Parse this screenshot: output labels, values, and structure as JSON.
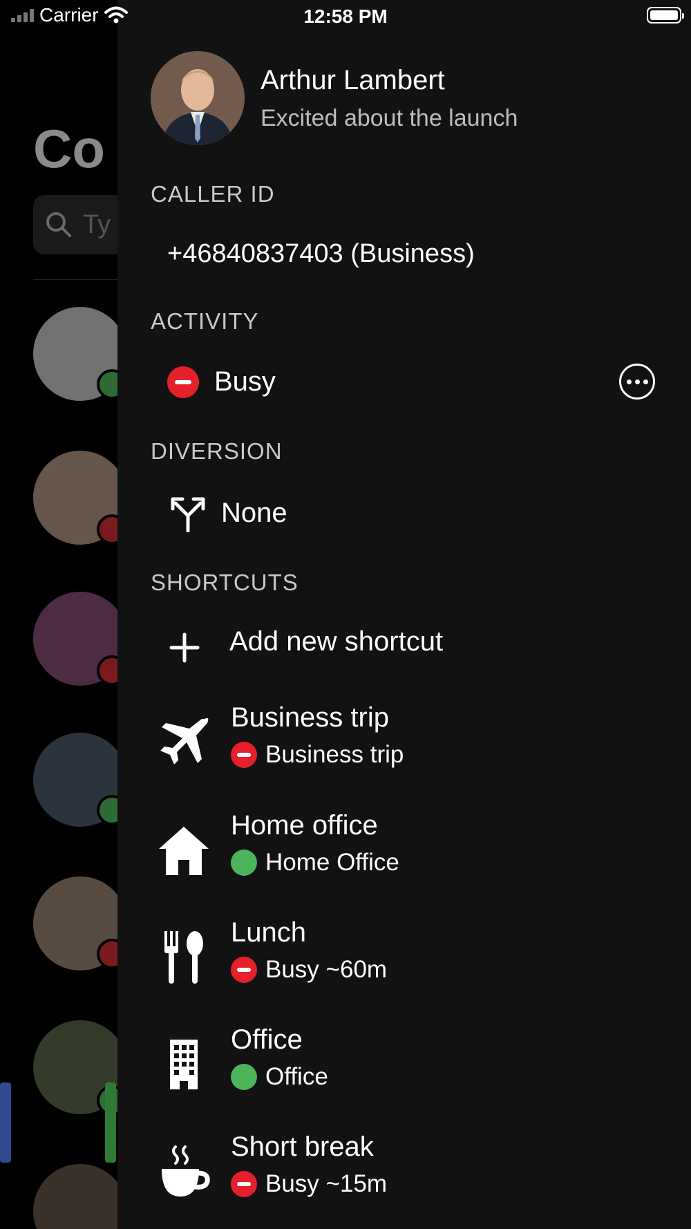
{
  "status_bar": {
    "carrier": "Carrier",
    "time": "12:58 PM"
  },
  "background": {
    "title_partial": "Co",
    "search_placeholder_partial": "Ty"
  },
  "profile": {
    "name": "Arthur Lambert",
    "status_message": "Excited about the launch"
  },
  "caller_id": {
    "section": "CALLER ID",
    "value": "+46840837403 (Business)"
  },
  "activity": {
    "section": "ACTIVITY",
    "value": "Busy"
  },
  "diversion": {
    "section": "DIVERSION",
    "value": "None"
  },
  "shortcuts": {
    "section": "SHORTCUTS",
    "add_label": "Add new shortcut",
    "items": [
      {
        "title": "Business trip",
        "status": "Business trip",
        "icon": "airplane-icon",
        "status_color": "red"
      },
      {
        "title": "Home office",
        "status": "Home Office",
        "icon": "home-icon",
        "status_color": "green"
      },
      {
        "title": "Lunch",
        "status": "Busy ~60m",
        "icon": "utensils-icon",
        "status_color": "red"
      },
      {
        "title": "Office",
        "status": "Office",
        "icon": "building-icon",
        "status_color": "green"
      },
      {
        "title": "Short break",
        "status": "Busy ~15m",
        "icon": "coffee-icon",
        "status_color": "red"
      }
    ]
  },
  "colors": {
    "busy": "#e5202b",
    "available": "#4cb55a",
    "drawer_bg": "#121212"
  }
}
